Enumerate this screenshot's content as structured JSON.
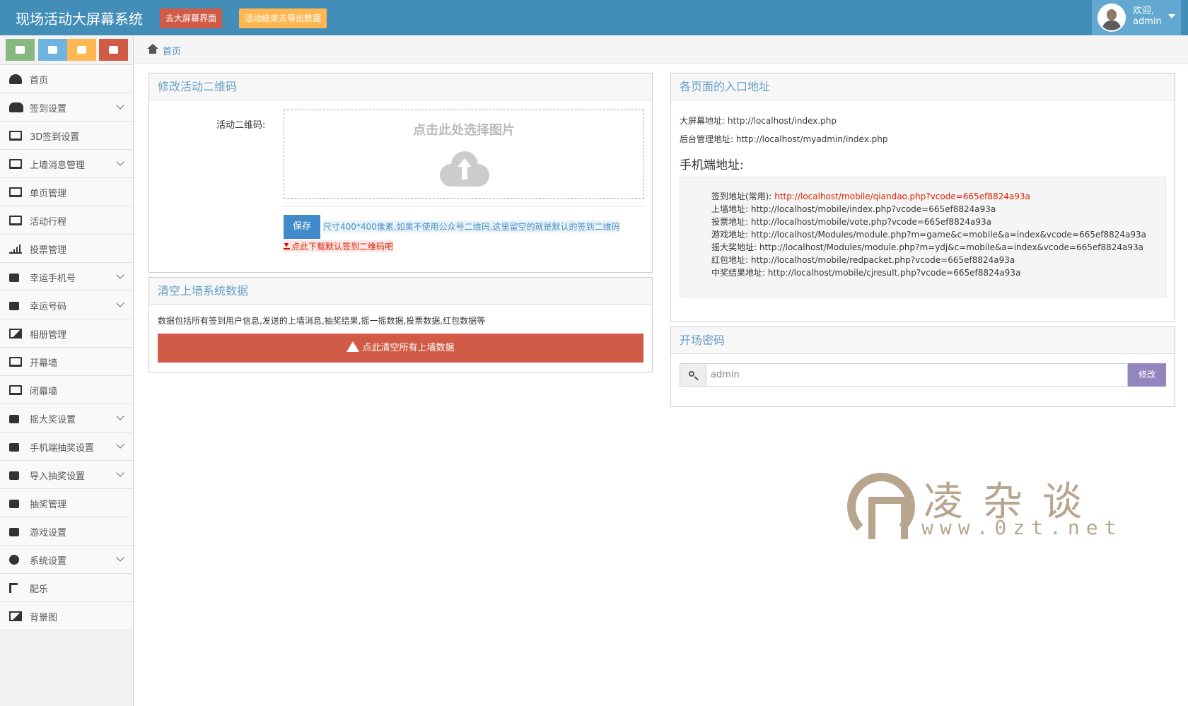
{
  "navbar": {
    "brand": "现场活动大屏幕系统",
    "btn_screen": "去大屏幕界面",
    "btn_export": "活动结束去导出数据",
    "welcome": "欢迎,",
    "username": "admin"
  },
  "sidebar": {
    "items": [
      {
        "label": "首页"
      },
      {
        "label": "签到设置"
      },
      {
        "label": "3D签到设置"
      },
      {
        "label": "上墙消息管理"
      },
      {
        "label": "单页管理"
      },
      {
        "label": "活动行程"
      },
      {
        "label": "投票管理"
      },
      {
        "label": "幸运手机号"
      },
      {
        "label": "幸运号码"
      },
      {
        "label": "相册管理"
      },
      {
        "label": "开幕墙"
      },
      {
        "label": "闭幕墙"
      },
      {
        "label": "摇大奖设置"
      },
      {
        "label": "手机端抽奖设置"
      },
      {
        "label": "导入抽奖设置"
      },
      {
        "label": "抽奖管理"
      },
      {
        "label": "游戏设置"
      },
      {
        "label": "系统设置"
      },
      {
        "label": "配乐"
      },
      {
        "label": "背景图"
      }
    ]
  },
  "breadcrumb": {
    "home": "首页"
  },
  "qr_widget": {
    "title": "修改活动二维码",
    "label": "活动二维码:",
    "upload_text": "点击此处选择图片",
    "save": "保存",
    "hint": "尺寸400*400像素,如果不使用公众号二维码,这里留空的就是默认的签到二维码",
    "download": "点此下载默认签到二维码吧"
  },
  "clear_widget": {
    "title": "清空上墙系统数据",
    "desc": "数据包括所有签到用户信息,发送的上墙消息,抽奖结果,摇一摇数据,投票数据,红包数据等",
    "button": "点此清空所有上墙数据"
  },
  "entry_widget": {
    "title": "各页面的入口地址",
    "bigscreen": "大屏幕地址:  http://localhost/index.php",
    "admin": "后台管理地址:  http://localhost/myadmin/index.php",
    "mobile_title": "手机端地址:",
    "signin_label": "签到地址(常用):",
    "signin_url": "http://localhost/mobile/qiandao.php?vcode=665ef8824a93a",
    "wall": "上墙地址:  http://localhost/mobile/index.php?vcode=665ef8824a93a",
    "vote": "投票地址:  http://localhost/mobile/vote.php?vcode=665ef8824a93a",
    "game": "游戏地址:  http://localhost/Modules/module.php?m=game&c=mobile&a=index&vcode=665ef8824a93a",
    "shake": "摇大奖地址:  http://localhost/Modules/module.php?m=ydj&c=mobile&a=index&vcode=665ef8824a93a",
    "redpacket": "红包地址:  http://localhost/mobile/redpacket.php?vcode=665ef8824a93a",
    "result": "中奖结果地址:  http://localhost/mobile/cjresult.php?vcode=665ef8824a93a"
  },
  "password_widget": {
    "title": "开场密码",
    "value": "admin",
    "button": "修改"
  },
  "watermark": {
    "cn": "凌杂谈",
    "en": "www.0zt.net"
  },
  "colors": {
    "navbar": "#438eb9",
    "danger": "#d15b47",
    "warning": "#ffb752",
    "primary": "#428bca",
    "purple": "#9585bf"
  }
}
